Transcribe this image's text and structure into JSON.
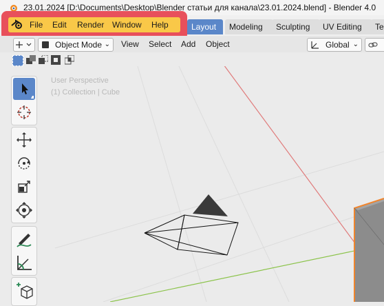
{
  "window": {
    "title": "23.01.2024 [D:\\Documents\\Desktop\\Blender статьи для канала\\23.01.2024.blend] - Blender 4.0"
  },
  "menu": {
    "items": [
      "File",
      "Edit",
      "Render",
      "Window",
      "Help"
    ]
  },
  "tabs": [
    "Layout",
    "Modeling",
    "Sculpting",
    "UV Editing",
    "Te"
  ],
  "header": {
    "mode": "Object Mode",
    "menus": [
      "View",
      "Select",
      "Add",
      "Object"
    ],
    "transform_orientation": "Global"
  },
  "viewport": {
    "perspective_label": "User Perspective",
    "collection_label": "(1) Collection | Cube"
  },
  "tools": [
    "select-box-icon",
    "cursor-icon",
    "move-icon",
    "rotate-icon",
    "scale-icon",
    "transform-icon",
    "annotate-icon",
    "measure-icon",
    "add-cube-icon"
  ],
  "colors": {
    "highlight_outer": "#e8505b",
    "highlight_inner": "#f9c848",
    "active_tab": "#5b87c9",
    "x_axis": "#e07a7a",
    "y_axis": "#8bc34a",
    "selected_outline": "#f0842c"
  }
}
